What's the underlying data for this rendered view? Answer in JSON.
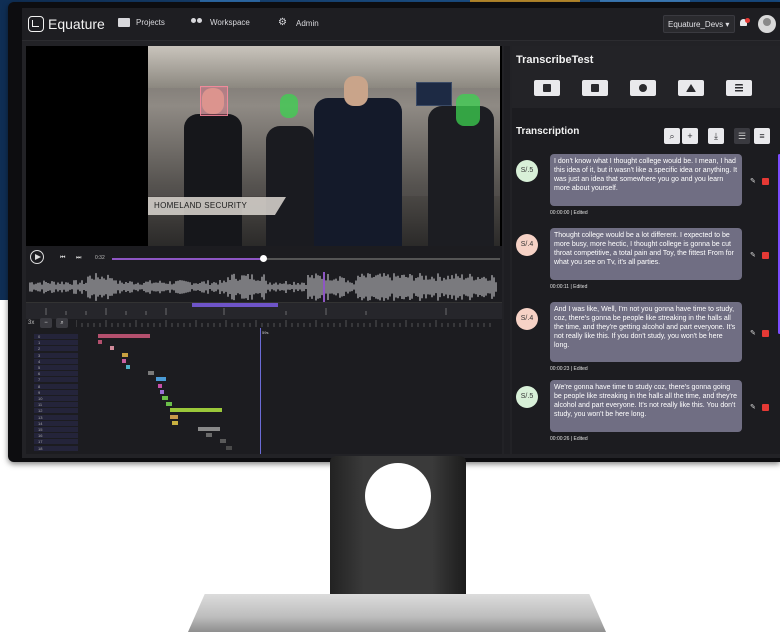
{
  "nav": {
    "brand": "Equature",
    "items": [
      {
        "label": "Projects",
        "icon": "projects-icon"
      },
      {
        "label": "Workspace",
        "icon": "people-icon"
      },
      {
        "label": "Admin",
        "icon": "admin-gear-icon"
      }
    ],
    "workspace_select": "Equature_Devs ▾"
  },
  "video": {
    "overlay_caption": "HOMELAND SECURITY",
    "time": "0:32",
    "progress": 0.39
  },
  "timeline": {
    "zoom_label": "3x",
    "rows": [
      "0",
      "1",
      "2",
      "3",
      "4",
      "5",
      "6",
      "7",
      "8",
      "9",
      "10",
      "11",
      "12",
      "13",
      "14",
      "15",
      "16",
      "17",
      "18"
    ],
    "ruler_marks": [
      "59s"
    ]
  },
  "panel": {
    "project_title": "TranscribeTest",
    "transcription_title": "Transcription",
    "toolbar_icons": [
      "save-icon",
      "export-icon",
      "settings-icon",
      "shapes-icon",
      "list-icon"
    ],
    "tools": [
      "search-icon",
      "add-icon",
      "download-icon",
      "list-view-icon",
      "text-view-icon"
    ]
  },
  "transcripts": [
    {
      "speaker": "S/.5",
      "speaker_color": "#d8f0d8",
      "text": "I don't know what I thought college would be. I mean, I had this idea of it, but it wasn't like a specific idea or anything. It was just an idea that somewhere you go and you learn more about yourself.",
      "time": "00:00:00",
      "status": "Edited"
    },
    {
      "speaker": "S/.4",
      "speaker_color": "#f6d2c6",
      "text": "Thought college would be a lot different. I expected to be more busy, more hectic, I thought college is gonna be cut throat competitive, a total pain and Toy, the fittest From for what you see on Tv, it's all parties.",
      "time": "00:00:11",
      "status": "Edited"
    },
    {
      "speaker": "S/.4",
      "speaker_color": "#f6d2c6",
      "text": "And I was like, Well, I'm not you gonna have time to study, coz, there's gonna be people like streaking in the halls all the time, and they're getting alcohol and part everyone. It's not really like this. If you don't study, you won't be here long.",
      "time": "00:00:23",
      "status": "Edited"
    },
    {
      "speaker": "S/.5",
      "speaker_color": "#d8f0d8",
      "text": "We're gonna have time to study coz, there's gonna going be people like streaking in the halls all the time, and they're alcohol and part everyone. It's not really like this. You don't study, you won't be here long.",
      "time": "00:00:26",
      "status": "Edited"
    }
  ]
}
